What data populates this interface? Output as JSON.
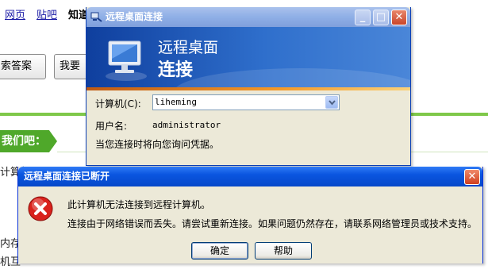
{
  "background_page": {
    "nav_links": [
      "网页",
      "贴吧"
    ],
    "nav_bold": "知道",
    "search_button_label": "索答案",
    "ask_button_label": "我要",
    "tab_label": "我们吧：",
    "text_line1": "计算机",
    "text_line2": "内存",
    "text_line3": "机互"
  },
  "rdp_window": {
    "title": "远程桌面连接",
    "banner_line1": "远程桌面",
    "banner_line2": "连接",
    "computer_label": "计算机(C):",
    "computer_value": "liheming",
    "username_label": "用户名:",
    "username_value": "administrator",
    "info_text": "当您连接时将向您询问凭据。"
  },
  "error_dialog": {
    "title": "远程桌面连接已断开",
    "message_line1": "此计算机无法连接到远程计算机。",
    "message_line2": "连接由于网络错误而丢失。请尝试重新连接。如果问题仍然存在，请联系网络管理员或技术支持。",
    "ok_label": "确定",
    "help_label": "帮助"
  },
  "colors": {
    "error_titlebar": "#0a55e0",
    "rdp_titlebar_inactive": "#8fafe6",
    "dialog_face": "#ece9d8",
    "page_green": "#4fa82a"
  }
}
